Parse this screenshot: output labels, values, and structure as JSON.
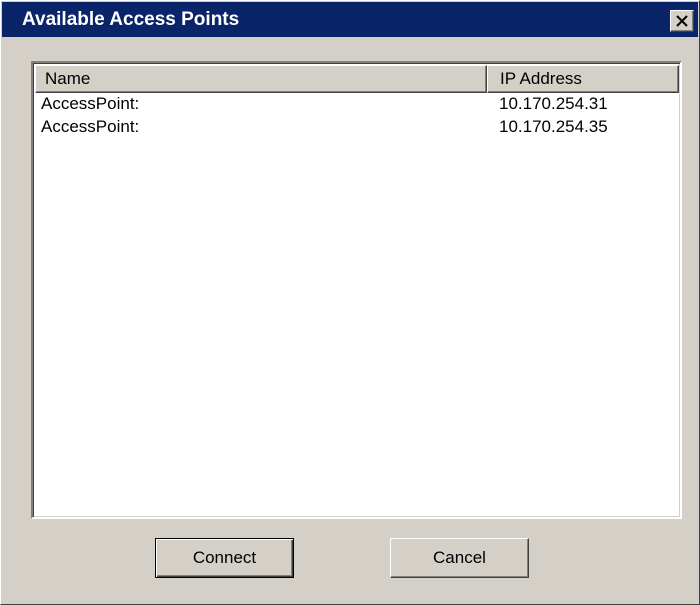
{
  "window": {
    "title": "Available Access Points"
  },
  "colors": {
    "titlebar": "#0a246a",
    "face": "#d4d0c8",
    "list_background": "#ffffff"
  },
  "icons": {
    "close": "close-icon"
  },
  "list": {
    "columns": [
      "Name",
      "IP Address"
    ],
    "rows": [
      {
        "name": "AccessPoint:",
        "ip": "10.170.254.31"
      },
      {
        "name": "AccessPoint:",
        "ip": "10.170.254.35"
      }
    ]
  },
  "buttons": {
    "connect_label": "Connect",
    "cancel_label": "Cancel"
  }
}
